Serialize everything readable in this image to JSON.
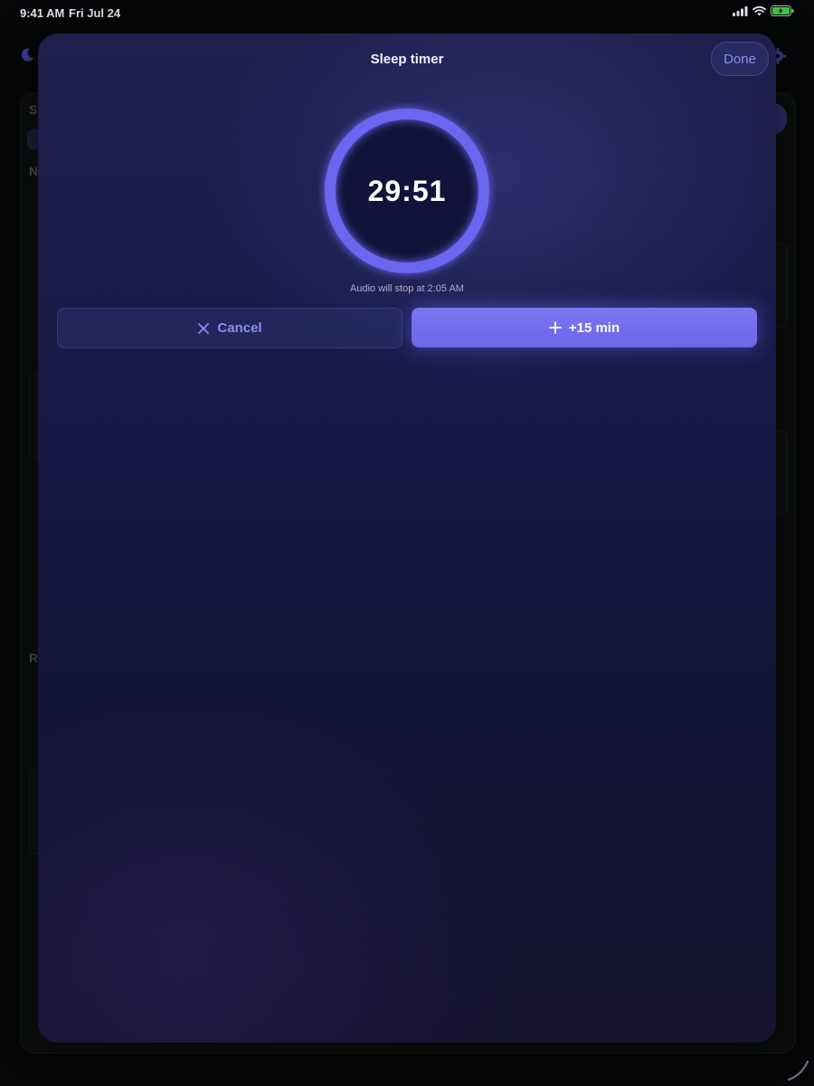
{
  "status_bar": {
    "time": "9:41 AM",
    "date": "Fri Jul 24",
    "icons": [
      "cellular-signal-icon",
      "wifi-icon",
      "battery-charging-icon"
    ]
  },
  "background_app": {
    "letters": [
      "S",
      "N",
      "R"
    ],
    "icons": [
      "moon-icon",
      "gear-icon"
    ]
  },
  "sheet": {
    "title": "Sleep timer",
    "done_label": "Done",
    "countdown": "29:51",
    "progress": 1.0,
    "stop_text": "Audio will stop at 2:05 AM",
    "cancel_label": "Cancel",
    "add_label": "+15 min"
  },
  "colors": {
    "accent": "#6f69ec",
    "ring": "#6b66f0",
    "sheet_background": "#1a1b47"
  }
}
